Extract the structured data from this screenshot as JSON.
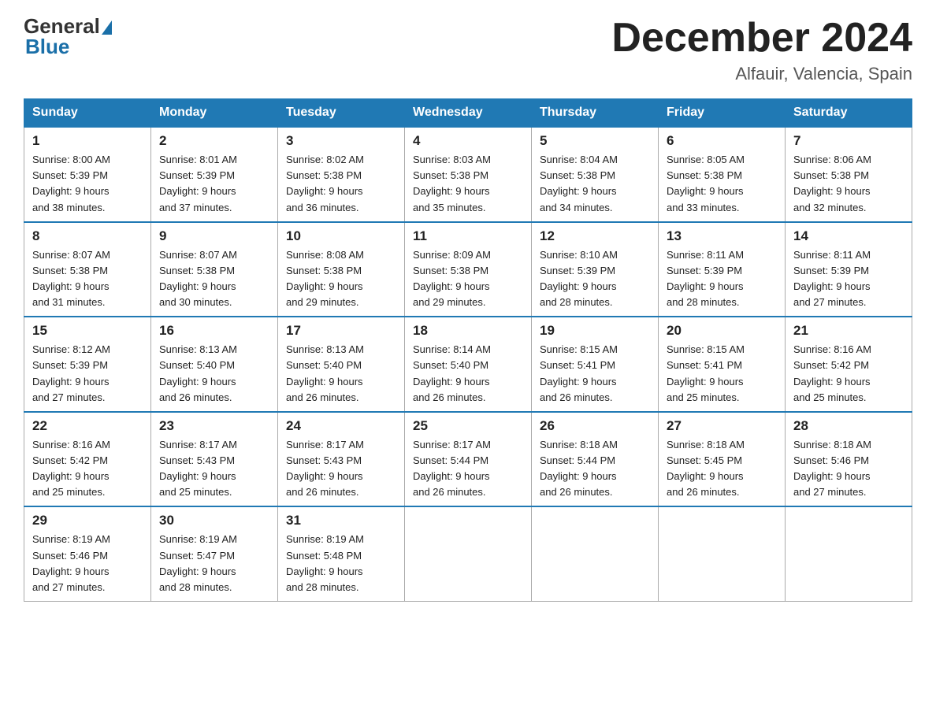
{
  "header": {
    "logo_general": "General",
    "logo_blue": "Blue",
    "month_title": "December 2024",
    "location": "Alfauir, Valencia, Spain"
  },
  "days_of_week": [
    "Sunday",
    "Monday",
    "Tuesday",
    "Wednesday",
    "Thursday",
    "Friday",
    "Saturday"
  ],
  "weeks": [
    [
      {
        "day": "1",
        "sunrise": "8:00 AM",
        "sunset": "5:39 PM",
        "daylight": "9 hours and 38 minutes."
      },
      {
        "day": "2",
        "sunrise": "8:01 AM",
        "sunset": "5:39 PM",
        "daylight": "9 hours and 37 minutes."
      },
      {
        "day": "3",
        "sunrise": "8:02 AM",
        "sunset": "5:38 PM",
        "daylight": "9 hours and 36 minutes."
      },
      {
        "day": "4",
        "sunrise": "8:03 AM",
        "sunset": "5:38 PM",
        "daylight": "9 hours and 35 minutes."
      },
      {
        "day": "5",
        "sunrise": "8:04 AM",
        "sunset": "5:38 PM",
        "daylight": "9 hours and 34 minutes."
      },
      {
        "day": "6",
        "sunrise": "8:05 AM",
        "sunset": "5:38 PM",
        "daylight": "9 hours and 33 minutes."
      },
      {
        "day": "7",
        "sunrise": "8:06 AM",
        "sunset": "5:38 PM",
        "daylight": "9 hours and 32 minutes."
      }
    ],
    [
      {
        "day": "8",
        "sunrise": "8:07 AM",
        "sunset": "5:38 PM",
        "daylight": "9 hours and 31 minutes."
      },
      {
        "day": "9",
        "sunrise": "8:07 AM",
        "sunset": "5:38 PM",
        "daylight": "9 hours and 30 minutes."
      },
      {
        "day": "10",
        "sunrise": "8:08 AM",
        "sunset": "5:38 PM",
        "daylight": "9 hours and 29 minutes."
      },
      {
        "day": "11",
        "sunrise": "8:09 AM",
        "sunset": "5:38 PM",
        "daylight": "9 hours and 29 minutes."
      },
      {
        "day": "12",
        "sunrise": "8:10 AM",
        "sunset": "5:39 PM",
        "daylight": "9 hours and 28 minutes."
      },
      {
        "day": "13",
        "sunrise": "8:11 AM",
        "sunset": "5:39 PM",
        "daylight": "9 hours and 28 minutes."
      },
      {
        "day": "14",
        "sunrise": "8:11 AM",
        "sunset": "5:39 PM",
        "daylight": "9 hours and 27 minutes."
      }
    ],
    [
      {
        "day": "15",
        "sunrise": "8:12 AM",
        "sunset": "5:39 PM",
        "daylight": "9 hours and 27 minutes."
      },
      {
        "day": "16",
        "sunrise": "8:13 AM",
        "sunset": "5:40 PM",
        "daylight": "9 hours and 26 minutes."
      },
      {
        "day": "17",
        "sunrise": "8:13 AM",
        "sunset": "5:40 PM",
        "daylight": "9 hours and 26 minutes."
      },
      {
        "day": "18",
        "sunrise": "8:14 AM",
        "sunset": "5:40 PM",
        "daylight": "9 hours and 26 minutes."
      },
      {
        "day": "19",
        "sunrise": "8:15 AM",
        "sunset": "5:41 PM",
        "daylight": "9 hours and 26 minutes."
      },
      {
        "day": "20",
        "sunrise": "8:15 AM",
        "sunset": "5:41 PM",
        "daylight": "9 hours and 25 minutes."
      },
      {
        "day": "21",
        "sunrise": "8:16 AM",
        "sunset": "5:42 PM",
        "daylight": "9 hours and 25 minutes."
      }
    ],
    [
      {
        "day": "22",
        "sunrise": "8:16 AM",
        "sunset": "5:42 PM",
        "daylight": "9 hours and 25 minutes."
      },
      {
        "day": "23",
        "sunrise": "8:17 AM",
        "sunset": "5:43 PM",
        "daylight": "9 hours and 25 minutes."
      },
      {
        "day": "24",
        "sunrise": "8:17 AM",
        "sunset": "5:43 PM",
        "daylight": "9 hours and 26 minutes."
      },
      {
        "day": "25",
        "sunrise": "8:17 AM",
        "sunset": "5:44 PM",
        "daylight": "9 hours and 26 minutes."
      },
      {
        "day": "26",
        "sunrise": "8:18 AM",
        "sunset": "5:44 PM",
        "daylight": "9 hours and 26 minutes."
      },
      {
        "day": "27",
        "sunrise": "8:18 AM",
        "sunset": "5:45 PM",
        "daylight": "9 hours and 26 minutes."
      },
      {
        "day": "28",
        "sunrise": "8:18 AM",
        "sunset": "5:46 PM",
        "daylight": "9 hours and 27 minutes."
      }
    ],
    [
      {
        "day": "29",
        "sunrise": "8:19 AM",
        "sunset": "5:46 PM",
        "daylight": "9 hours and 27 minutes."
      },
      {
        "day": "30",
        "sunrise": "8:19 AM",
        "sunset": "5:47 PM",
        "daylight": "9 hours and 28 minutes."
      },
      {
        "day": "31",
        "sunrise": "8:19 AM",
        "sunset": "5:48 PM",
        "daylight": "9 hours and 28 minutes."
      },
      null,
      null,
      null,
      null
    ]
  ]
}
